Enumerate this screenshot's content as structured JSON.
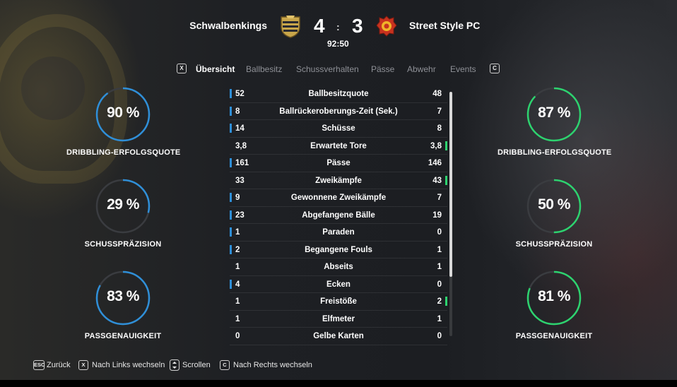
{
  "header": {
    "home_team": "Schwalbenkings",
    "away_team": "Street Style PC",
    "home_score": "4",
    "score_separator": ":",
    "away_score": "3",
    "match_clock": "92:50"
  },
  "tabs": {
    "prev_key": "X",
    "next_key": "C",
    "items": [
      "Übersicht",
      "Ballbesitz",
      "Schussverhalten",
      "Pässe",
      "Abwehr",
      "Events"
    ],
    "active": "Übersicht"
  },
  "home_rings": [
    {
      "value": "90 %",
      "label": "DRIBBLING-ERFOLGSQUOTE",
      "fraction": 0.9
    },
    {
      "value": "29 %",
      "label": "SCHUSSPRÄZISION",
      "fraction": 0.29
    },
    {
      "value": "83 %",
      "label": "PASSGENAUIGKEIT",
      "fraction": 0.83
    }
  ],
  "away_rings": [
    {
      "value": "87 %",
      "label": "DRIBBLING-ERFOLGSQUOTE",
      "fraction": 0.87
    },
    {
      "value": "50 %",
      "label": "SCHUSSPRÄZISION",
      "fraction": 0.5
    },
    {
      "value": "81 %",
      "label": "PASSGENAUIGKEIT",
      "fraction": 0.81
    }
  ],
  "colors": {
    "home_accent": "#2f8fd8",
    "away_accent": "#2dd36f",
    "ring_track": "#3a3c40"
  },
  "stats": [
    {
      "home": "52",
      "label": "Ballbesitzquote",
      "away": "48",
      "leader": "home"
    },
    {
      "home": "8",
      "label": "Ballrückeroberungs-Zeit (Sek.)",
      "away": "7",
      "leader": "home"
    },
    {
      "home": "14",
      "label": "Schüsse",
      "away": "8",
      "leader": "home"
    },
    {
      "home": "3,8",
      "label": "Erwartete Tore",
      "away": "3,8",
      "leader": "away"
    },
    {
      "home": "161",
      "label": "Pässe",
      "away": "146",
      "leader": "home"
    },
    {
      "home": "33",
      "label": "Zweikämpfe",
      "away": "43",
      "leader": "away"
    },
    {
      "home": "9",
      "label": "Gewonnene Zweikämpfe",
      "away": "7",
      "leader": "home"
    },
    {
      "home": "23",
      "label": "Abgefangene Bälle",
      "away": "19",
      "leader": "home"
    },
    {
      "home": "1",
      "label": "Paraden",
      "away": "0",
      "leader": "home"
    },
    {
      "home": "2",
      "label": "Begangene Fouls",
      "away": "1",
      "leader": "home"
    },
    {
      "home": "1",
      "label": "Abseits",
      "away": "1",
      "leader": "none"
    },
    {
      "home": "4",
      "label": "Ecken",
      "away": "0",
      "leader": "home"
    },
    {
      "home": "1",
      "label": "Freistöße",
      "away": "2",
      "leader": "away"
    },
    {
      "home": "1",
      "label": "Elfmeter",
      "away": "1",
      "leader": "none"
    },
    {
      "home": "0",
      "label": "Gelbe Karten",
      "away": "0",
      "leader": "none"
    }
  ],
  "footer": {
    "back_key": "ESC",
    "back_label": "Zurück",
    "left_key": "X",
    "left_label": "Nach Links wechseln",
    "scroll_label": "Scrollen",
    "right_key": "C",
    "right_label": "Nach Rechts wechseln"
  }
}
